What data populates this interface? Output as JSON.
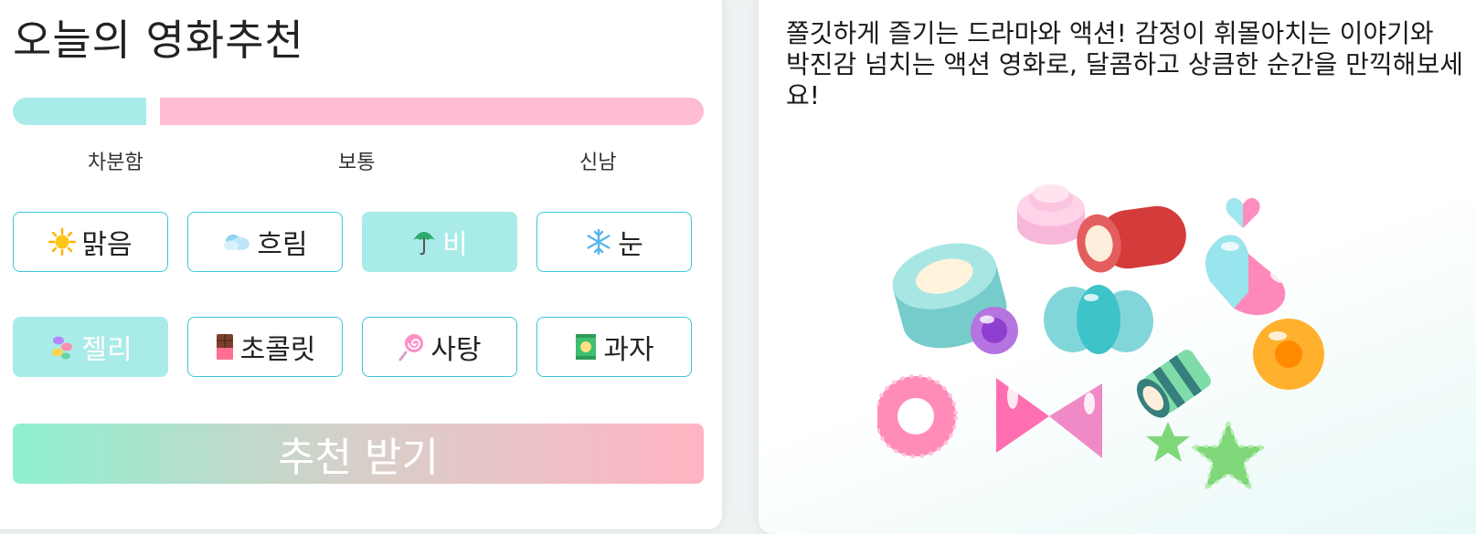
{
  "app": {
    "title": "오늘의 영화추천"
  },
  "mood": {
    "labels": {
      "low": "차분함",
      "mid": "보통",
      "high": "신남"
    },
    "value_fraction": 0.2
  },
  "weather": [
    {
      "label": "맑음",
      "icon": "sun-icon",
      "selected": false
    },
    {
      "label": "흐림",
      "icon": "cloud-icon",
      "selected": false
    },
    {
      "label": "비",
      "icon": "umbrella-icon",
      "selected": true
    },
    {
      "label": "눈",
      "icon": "snowflake-icon",
      "selected": false
    }
  ],
  "snacks": [
    {
      "label": "젤리",
      "icon": "jellybean-icon",
      "selected": true
    },
    {
      "label": "초콜릿",
      "icon": "chocolate-icon",
      "selected": false
    },
    {
      "label": "사탕",
      "icon": "lollipop-icon",
      "selected": false
    },
    {
      "label": "과자",
      "icon": "snack-bag-icon",
      "selected": false
    }
  ],
  "submit_label": "추천 받기",
  "result": {
    "description": "쫄깃하게 즐기는 드라마와 액션! 감정이 휘몰아치는 이야기와 박진감 넘치는 액션 영화로, 달콤하고 상큼한 순간을 만끽해보세요!"
  },
  "colors": {
    "accent": "#a9ebe8",
    "pink": "#ffbdd2",
    "border": "#3cc6d6"
  }
}
